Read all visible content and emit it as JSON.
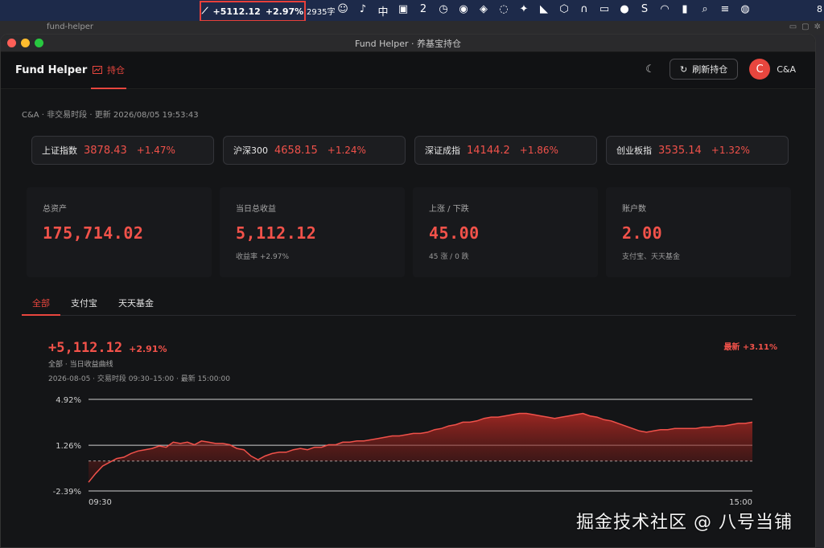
{
  "menubar": {
    "stock_change": "+5112.12",
    "stock_pct": "+2.97%",
    "word_count": "2935字",
    "icons": [
      "face-icon",
      "mic-icon",
      "input-method-icon",
      "shirt-icon",
      "badge-2-icon",
      "clock-icon",
      "circle-icon",
      "box-icon",
      "wechat-icon",
      "star-app-icon",
      "arrow-app-icon",
      "hexagon-icon",
      "arch-icon",
      "window-icon",
      "user-icon",
      "s-app-icon",
      "wifi-icon",
      "battery-icon",
      "search-icon",
      "control-center-icon",
      "siri-icon"
    ],
    "badge_num": "2",
    "time_stub": "8"
  },
  "bgwindow": {
    "title": "fund-helper"
  },
  "window": {
    "title": "Fund Helper · 养基宝持仓"
  },
  "header": {
    "brand": "Fund Helper",
    "nav_holdings": "持仓",
    "refresh_label": "刷新持仓",
    "avatar_letter": "C",
    "username": "C&A"
  },
  "status": "C&A · 非交易时段 · 更新 2026/08/05 19:53:43",
  "indices": [
    {
      "name": "上证指数",
      "value": "3878.43",
      "change": "+1.47%"
    },
    {
      "name": "沪深300",
      "value": "4658.15",
      "change": "+1.24%"
    },
    {
      "name": "深证成指",
      "value": "14144.2",
      "change": "+1.86%"
    },
    {
      "name": "创业板指",
      "value": "3535.14",
      "change": "+1.32%"
    }
  ],
  "stats": [
    {
      "label": "总资产",
      "value": "175,714.02",
      "sub": ""
    },
    {
      "label": "当日总收益",
      "value": "5,112.12",
      "sub": "收益率 +2.97%"
    },
    {
      "label": "上涨 / 下跌",
      "value": "45.00",
      "sub": "45 涨 / 0 跌"
    },
    {
      "label": "账户数",
      "value": "2.00",
      "sub": "支付宝、天天基金"
    }
  ],
  "tabs": [
    "全部",
    "支付宝",
    "天天基金"
  ],
  "chart_header": {
    "total": "+5,112.12",
    "pct": "+2.91%",
    "subtitle": "全部 · 当日收益曲线",
    "meta": "2026-08-05 · 交易时段 09:30–15:00 · 最新 15:00:00",
    "latest": "最新 +3.11%"
  },
  "colors": {
    "accent": "#e8463e",
    "up": "#f2524a",
    "bg": "#141517"
  },
  "chart_data": {
    "type": "area",
    "ylim": [
      -2.39,
      4.92
    ],
    "yticks": [
      "4.92%",
      "1.26%",
      "-2.39%"
    ],
    "ytick_values": [
      4.92,
      1.26,
      -2.39
    ],
    "xticks": [
      "09:30",
      "15:00"
    ],
    "baseline": 0,
    "series": [
      {
        "values": [
          -1.7,
          -1.0,
          -0.4,
          -0.1,
          0.2,
          0.3,
          0.6,
          0.8,
          0.9,
          1.0,
          1.2,
          1.1,
          1.5,
          1.4,
          1.5,
          1.3,
          1.6,
          1.5,
          1.4,
          1.4,
          1.3,
          1.0,
          0.9,
          0.4,
          0.1,
          0.4,
          0.6,
          0.7,
          0.7,
          0.9,
          1.0,
          0.9,
          1.1,
          1.1,
          1.3,
          1.3,
          1.5,
          1.5,
          1.6,
          1.6,
          1.7,
          1.8,
          1.9,
          2.0,
          2.0,
          2.1,
          2.2,
          2.2,
          2.3,
          2.5,
          2.6,
          2.8,
          2.9,
          3.1,
          3.1,
          3.2,
          3.4,
          3.5,
          3.5,
          3.6,
          3.7,
          3.8,
          3.8,
          3.7,
          3.6,
          3.5,
          3.4,
          3.5,
          3.6,
          3.7,
          3.8,
          3.6,
          3.5,
          3.3,
          3.2,
          3.0,
          2.8,
          2.6,
          2.4,
          2.3,
          2.4,
          2.5,
          2.5,
          2.6,
          2.6,
          2.6,
          2.6,
          2.7,
          2.7,
          2.8,
          2.8,
          2.9,
          3.0,
          3.0,
          3.1
        ]
      }
    ]
  }
}
